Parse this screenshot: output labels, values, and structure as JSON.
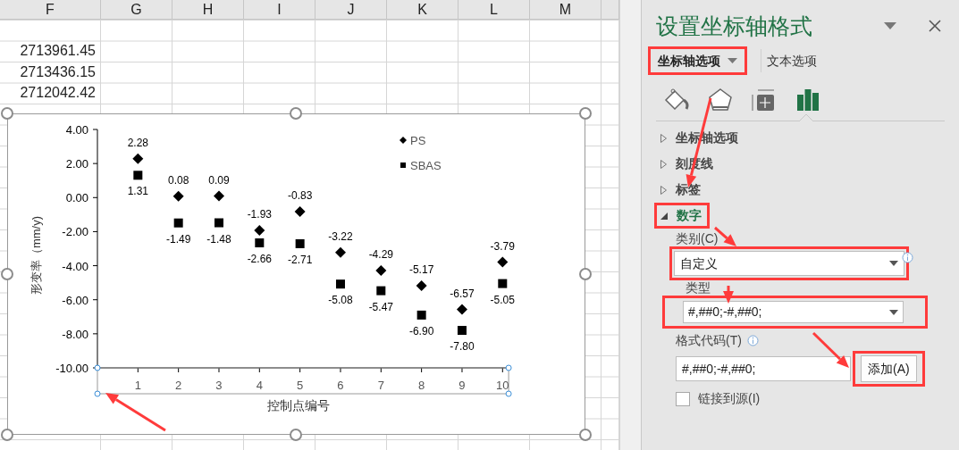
{
  "sheet": {
    "columns": [
      "F",
      "G",
      "H",
      "I",
      "J",
      "K",
      "L",
      "M"
    ],
    "column_f_values": [
      "2713961.45",
      "2713436.15",
      "2712042.42"
    ]
  },
  "chart": {
    "x_axis_selected": true,
    "chart_data": {
      "type": "scatter",
      "xlabel": "控制点编号",
      "ylabel": "形变率（mm/y)",
      "x": [
        1,
        2,
        3,
        4,
        5,
        6,
        7,
        8,
        9,
        10
      ],
      "series": [
        {
          "name": "PS",
          "color": "#000000",
          "marker": "diamond",
          "values": [
            2.28,
            0.08,
            0.09,
            -1.93,
            -0.83,
            -3.22,
            -4.29,
            -5.17,
            -6.57,
            -3.79
          ],
          "value_labels": [
            "2.28",
            "0.08",
            "0.09",
            "-1.93",
            "-0.83",
            "-3.22",
            "-4.29",
            "-5.17",
            "-6.57",
            "-3.79"
          ]
        },
        {
          "name": "SBAS",
          "color": "#000000",
          "marker": "square",
          "values": [
            1.31,
            -1.49,
            -1.48,
            -2.66,
            -2.71,
            -5.08,
            -5.47,
            -6.9,
            -7.8,
            -5.05
          ],
          "value_labels": [
            "1.31",
            "-1.49",
            "-1.48",
            "-2.66",
            "-2.71",
            "-5.08",
            "-5.47",
            "-6.90",
            "-7.80",
            "-5.05"
          ]
        }
      ],
      "legend": "top-right",
      "ylim": [
        -10,
        4
      ],
      "xlim": [
        0,
        10.15
      ],
      "yticks": [
        {
          "value": 4,
          "label": "4.00"
        },
        {
          "value": 2,
          "label": "2.00"
        },
        {
          "value": 0,
          "label": "0.00"
        },
        {
          "value": -2,
          "label": "-2.00"
        },
        {
          "value": -4,
          "label": "-4.00"
        },
        {
          "value": -6,
          "label": "-6.00"
        },
        {
          "value": -8,
          "label": "-8.00"
        },
        {
          "value": -10,
          "label": "-10.00"
        }
      ],
      "xticks": [
        1,
        2,
        3,
        4,
        5,
        6,
        7,
        8,
        9,
        10
      ]
    }
  },
  "panel": {
    "title": "设置坐标轴格式",
    "tabs": [
      {
        "label": "坐标轴选项",
        "selected": true,
        "highlighted": true
      },
      {
        "label": "文本选项",
        "selected": false,
        "highlighted": false
      }
    ],
    "icon_tabs": [
      {
        "selected": false
      },
      {
        "selected": false
      },
      {
        "selected": false
      },
      {
        "selected": true
      }
    ],
    "sections": [
      {
        "label": "坐标轴选项",
        "expanded": false,
        "highlighted": false
      },
      {
        "label": "刻度线",
        "expanded": false,
        "highlighted": false
      },
      {
        "label": "标签",
        "expanded": false,
        "highlighted": false
      },
      {
        "label": "数字",
        "expanded": true,
        "highlighted": true
      }
    ],
    "number": {
      "category": {
        "label": "类别(C)",
        "value": "自定义",
        "highlighted": true
      },
      "type": {
        "label": "类型",
        "value": "#,##0;-#,##0;",
        "highlighted": true
      },
      "format_code": {
        "label": "格式代码(T)",
        "value": "#,##0;-#,##0;"
      },
      "add_button": {
        "label": "添加(A)",
        "highlighted": true
      },
      "link_to_source": {
        "label": "链接到源(I)",
        "checked": false
      }
    }
  }
}
